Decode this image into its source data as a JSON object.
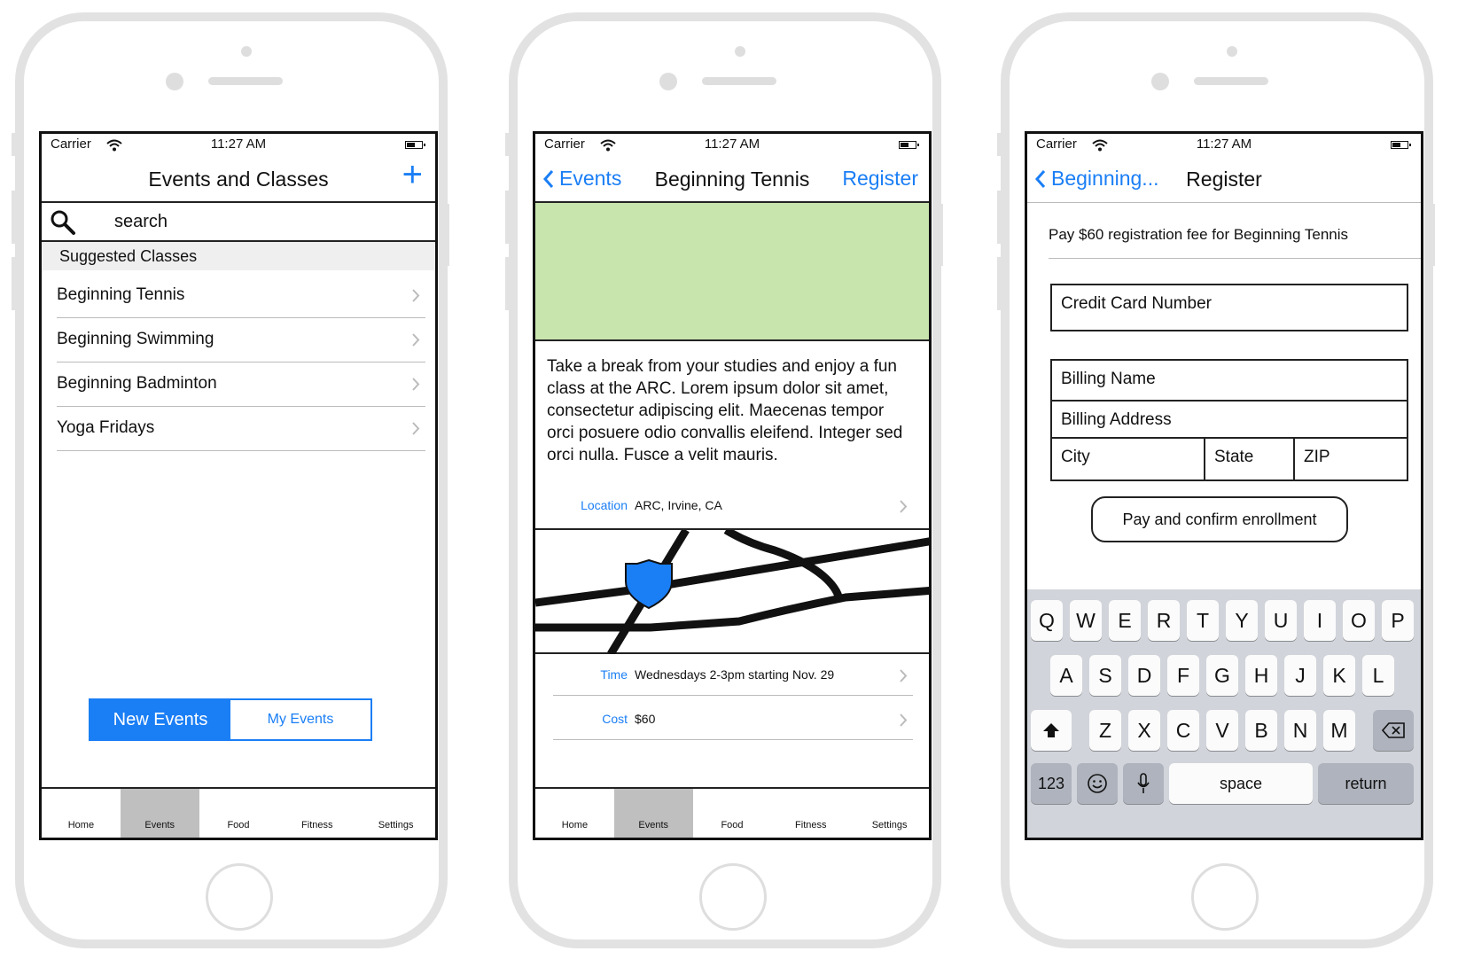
{
  "status": {
    "carrier": "Carrier",
    "time": "11:27 AM"
  },
  "screen1": {
    "title": "Events and Classes",
    "add_icon": "plus-icon",
    "search_placeholder": "search",
    "section_header": "Suggested Classes",
    "items": [
      "Beginning Tennis",
      "Beginning Swimming",
      "Beginning Badminton",
      "Yoga Fridays"
    ],
    "segments": [
      "New Events",
      "My Events"
    ],
    "selected_segment": "New Events"
  },
  "screen2": {
    "back_label": "Events",
    "title": "Beginning Tennis",
    "action_label": "Register",
    "description": "Take a break from your studies and enjoy a fun class at the ARC. Lorem ipsum dolor sit amet, consectetur adipiscing elit. Maecenas tempor orci posuere odio convallis eleifend. Integer sed orci nulla. Fusce a velit mauris.",
    "location_label": "Location",
    "location_value": "ARC, Irvine, CA",
    "time_label": "Time",
    "time_value": "Wednesdays 2-3pm starting Nov. 29",
    "cost_label": "Cost",
    "cost_value": "$60"
  },
  "screen3": {
    "back_label": "Beginning...",
    "title": "Register",
    "fee_text": "Pay $60 registration fee for Beginning Tennis",
    "fields": {
      "card": "Credit Card Number",
      "billing_name": "Billing Name",
      "billing_address": "Billing Address",
      "city": "City",
      "state": "State",
      "zip": "ZIP"
    },
    "pay_button": "Pay and confirm enrollment",
    "keyboard": {
      "row1": [
        "Q",
        "W",
        "E",
        "R",
        "T",
        "Y",
        "U",
        "I",
        "O",
        "P"
      ],
      "row2": [
        "A",
        "S",
        "D",
        "F",
        "G",
        "H",
        "J",
        "K",
        "L"
      ],
      "row3": [
        "Z",
        "X",
        "C",
        "V",
        "B",
        "N",
        "M"
      ],
      "numbers": "123",
      "space": "space",
      "return": "return"
    }
  },
  "tabs": [
    "Home",
    "Events",
    "Food",
    "Fitness",
    "Settings"
  ],
  "active_tab": "Events",
  "colors": {
    "accent": "#1a7ef5",
    "hero": "#c9e5ae",
    "keyboard_bg": "#d1d4da"
  }
}
